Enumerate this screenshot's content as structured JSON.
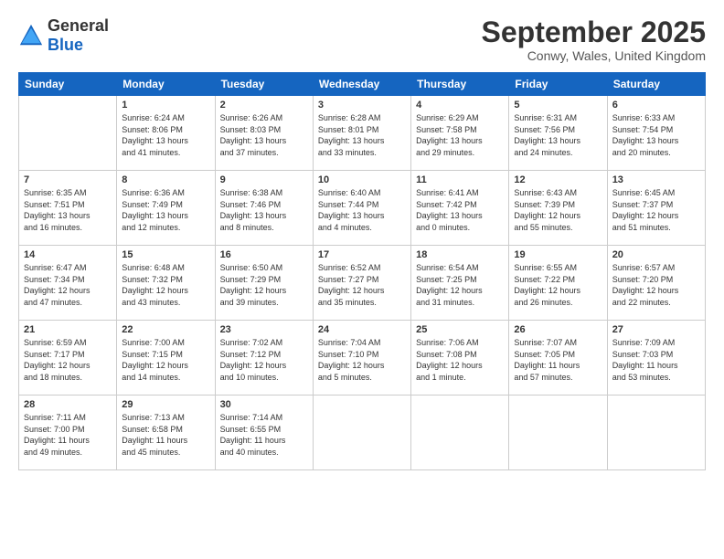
{
  "header": {
    "logo_general": "General",
    "logo_blue": "Blue",
    "month_title": "September 2025",
    "location": "Conwy, Wales, United Kingdom"
  },
  "weekdays": [
    "Sunday",
    "Monday",
    "Tuesday",
    "Wednesday",
    "Thursday",
    "Friday",
    "Saturday"
  ],
  "weeks": [
    [
      {
        "day": "",
        "info": ""
      },
      {
        "day": "1",
        "info": "Sunrise: 6:24 AM\nSunset: 8:06 PM\nDaylight: 13 hours\nand 41 minutes."
      },
      {
        "day": "2",
        "info": "Sunrise: 6:26 AM\nSunset: 8:03 PM\nDaylight: 13 hours\nand 37 minutes."
      },
      {
        "day": "3",
        "info": "Sunrise: 6:28 AM\nSunset: 8:01 PM\nDaylight: 13 hours\nand 33 minutes."
      },
      {
        "day": "4",
        "info": "Sunrise: 6:29 AM\nSunset: 7:58 PM\nDaylight: 13 hours\nand 29 minutes."
      },
      {
        "day": "5",
        "info": "Sunrise: 6:31 AM\nSunset: 7:56 PM\nDaylight: 13 hours\nand 24 minutes."
      },
      {
        "day": "6",
        "info": "Sunrise: 6:33 AM\nSunset: 7:54 PM\nDaylight: 13 hours\nand 20 minutes."
      }
    ],
    [
      {
        "day": "7",
        "info": "Sunrise: 6:35 AM\nSunset: 7:51 PM\nDaylight: 13 hours\nand 16 minutes."
      },
      {
        "day": "8",
        "info": "Sunrise: 6:36 AM\nSunset: 7:49 PM\nDaylight: 13 hours\nand 12 minutes."
      },
      {
        "day": "9",
        "info": "Sunrise: 6:38 AM\nSunset: 7:46 PM\nDaylight: 13 hours\nand 8 minutes."
      },
      {
        "day": "10",
        "info": "Sunrise: 6:40 AM\nSunset: 7:44 PM\nDaylight: 13 hours\nand 4 minutes."
      },
      {
        "day": "11",
        "info": "Sunrise: 6:41 AM\nSunset: 7:42 PM\nDaylight: 13 hours\nand 0 minutes."
      },
      {
        "day": "12",
        "info": "Sunrise: 6:43 AM\nSunset: 7:39 PM\nDaylight: 12 hours\nand 55 minutes."
      },
      {
        "day": "13",
        "info": "Sunrise: 6:45 AM\nSunset: 7:37 PM\nDaylight: 12 hours\nand 51 minutes."
      }
    ],
    [
      {
        "day": "14",
        "info": "Sunrise: 6:47 AM\nSunset: 7:34 PM\nDaylight: 12 hours\nand 47 minutes."
      },
      {
        "day": "15",
        "info": "Sunrise: 6:48 AM\nSunset: 7:32 PM\nDaylight: 12 hours\nand 43 minutes."
      },
      {
        "day": "16",
        "info": "Sunrise: 6:50 AM\nSunset: 7:29 PM\nDaylight: 12 hours\nand 39 minutes."
      },
      {
        "day": "17",
        "info": "Sunrise: 6:52 AM\nSunset: 7:27 PM\nDaylight: 12 hours\nand 35 minutes."
      },
      {
        "day": "18",
        "info": "Sunrise: 6:54 AM\nSunset: 7:25 PM\nDaylight: 12 hours\nand 31 minutes."
      },
      {
        "day": "19",
        "info": "Sunrise: 6:55 AM\nSunset: 7:22 PM\nDaylight: 12 hours\nand 26 minutes."
      },
      {
        "day": "20",
        "info": "Sunrise: 6:57 AM\nSunset: 7:20 PM\nDaylight: 12 hours\nand 22 minutes."
      }
    ],
    [
      {
        "day": "21",
        "info": "Sunrise: 6:59 AM\nSunset: 7:17 PM\nDaylight: 12 hours\nand 18 minutes."
      },
      {
        "day": "22",
        "info": "Sunrise: 7:00 AM\nSunset: 7:15 PM\nDaylight: 12 hours\nand 14 minutes."
      },
      {
        "day": "23",
        "info": "Sunrise: 7:02 AM\nSunset: 7:12 PM\nDaylight: 12 hours\nand 10 minutes."
      },
      {
        "day": "24",
        "info": "Sunrise: 7:04 AM\nSunset: 7:10 PM\nDaylight: 12 hours\nand 5 minutes."
      },
      {
        "day": "25",
        "info": "Sunrise: 7:06 AM\nSunset: 7:08 PM\nDaylight: 12 hours\nand 1 minute."
      },
      {
        "day": "26",
        "info": "Sunrise: 7:07 AM\nSunset: 7:05 PM\nDaylight: 11 hours\nand 57 minutes."
      },
      {
        "day": "27",
        "info": "Sunrise: 7:09 AM\nSunset: 7:03 PM\nDaylight: 11 hours\nand 53 minutes."
      }
    ],
    [
      {
        "day": "28",
        "info": "Sunrise: 7:11 AM\nSunset: 7:00 PM\nDaylight: 11 hours\nand 49 minutes."
      },
      {
        "day": "29",
        "info": "Sunrise: 7:13 AM\nSunset: 6:58 PM\nDaylight: 11 hours\nand 45 minutes."
      },
      {
        "day": "30",
        "info": "Sunrise: 7:14 AM\nSunset: 6:55 PM\nDaylight: 11 hours\nand 40 minutes."
      },
      {
        "day": "",
        "info": ""
      },
      {
        "day": "",
        "info": ""
      },
      {
        "day": "",
        "info": ""
      },
      {
        "day": "",
        "info": ""
      }
    ]
  ]
}
